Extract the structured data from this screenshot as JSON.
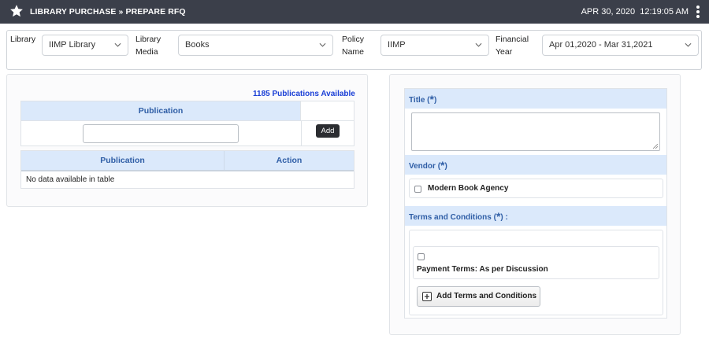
{
  "header": {
    "breadcrumb": "LIBRARY PURCHASE » PREPARE RFQ",
    "date": "APR 30, 2020",
    "time": "12:19:05 AM"
  },
  "filters": {
    "library_label": "Library",
    "library_value": "IIMP Library",
    "media_label_line1": "Library",
    "media_label_line2": "Media",
    "media_value": "Books",
    "policy_label_line1": "Policy",
    "policy_label_line2": "Name",
    "policy_value": "IIMP",
    "year_label_line1": "Financial",
    "year_label_line2": "Year",
    "year_value": "Apr 01,2020 - Mar 31,2021"
  },
  "publications": {
    "available_count": "1185 Publications Available",
    "column_header": "Publication",
    "add_button": "Add",
    "search_value": ""
  },
  "results_table": {
    "columns": [
      "Publication",
      "Action"
    ],
    "empty_message": "No data available in table"
  },
  "rfq_form": {
    "title_label": "Title",
    "title_value": "",
    "vendor_label": "Vendor",
    "vendors": [
      "Modern Book Agency"
    ],
    "terms_label": "Terms and Conditions",
    "terms": [
      "Payment Terms: As per Discussion"
    ],
    "add_terms_button": "Add Terms and Conditions",
    "required_mark": "*",
    "paren_open": "(",
    "paren_close": ")",
    "paren_close_colon": ") :"
  },
  "colors": {
    "topbar": "#3b3f4a",
    "table_header": "#dbe9fb",
    "header_text": "#2f5ea6",
    "count_text": "#1a3fd6"
  }
}
